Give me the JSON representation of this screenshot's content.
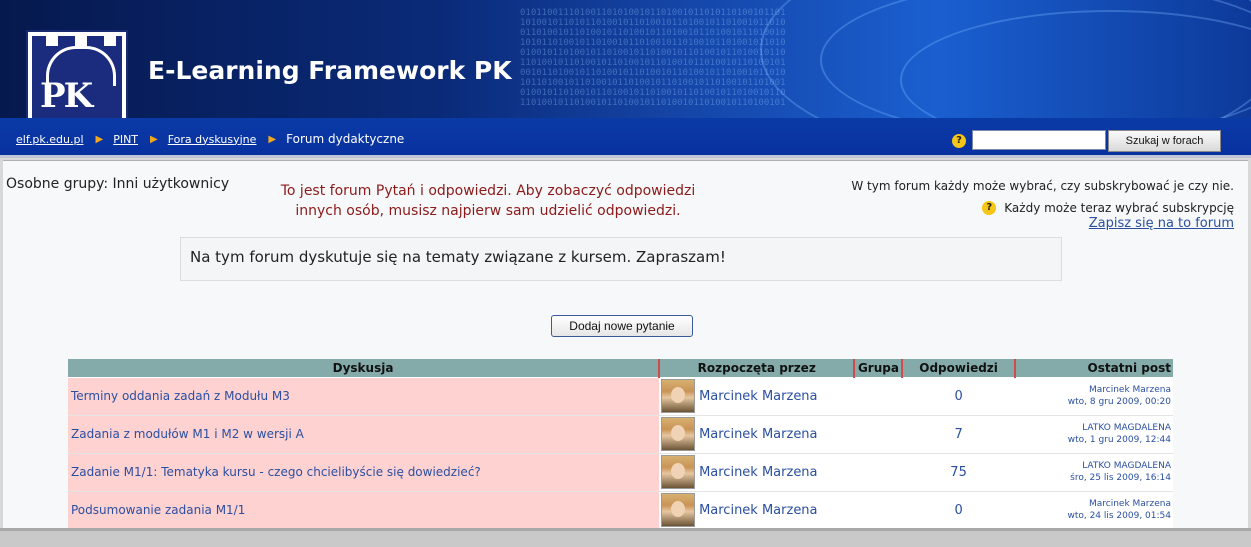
{
  "header": {
    "site_title": "E-Learning Framework PK",
    "logo_text": "PK"
  },
  "breadcrumb": {
    "items": [
      "elf.pk.edu.pl",
      "PINT",
      "Fora dyskusyjne"
    ],
    "current": "Forum dydaktyczne"
  },
  "search": {
    "value": "",
    "button_label": "Szukaj w forach",
    "help_icon": "?"
  },
  "forum": {
    "groups_label": "Osobne grupy: Inni użytkownicy",
    "qa_notice_line1": "To jest forum Pytań i odpowiedzi. Aby zobaczyć odpowiedzi",
    "qa_notice_line2": "innych osób, musisz najpierw sam udzielić odpowiedzi.",
    "subscribe_info_line1": "W tym forum każdy może wybrać, czy subskrybować je czy nie.",
    "subscribe_info_line2": "Każdy może teraz wybrać subskrypcję",
    "subscribe_help_icon": "?",
    "subscribe_link": "Zapisz się na to forum",
    "intro": "Na tym forum dyskutuje się na tematy związane z kursem. Zapraszam!",
    "add_question_label": "Dodaj nowe pytanie"
  },
  "table": {
    "headers": [
      "Dyskusja",
      "Rozpoczęta przez",
      "Grupa",
      "Odpowiedzi",
      "Ostatni post"
    ],
    "rows": [
      {
        "topic": "Terminy oddania zadań z Modułu M3",
        "author": "Marcinek Marzena",
        "group": "",
        "replies": "0",
        "last_author": "Marcinek Marzena",
        "last_date": "wto, 8 gru 2009, 00:20"
      },
      {
        "topic": "Zadania z modułów M1 i M2 w wersji A",
        "author": "Marcinek Marzena",
        "group": "",
        "replies": "7",
        "last_author": "LATKO MAGDALENA",
        "last_date": "wto, 1 gru 2009, 12:44"
      },
      {
        "topic": "Zadanie M1/1: Tematyka kursu - czego chcielibyście się dowiedzieć?",
        "author": "Marcinek Marzena",
        "group": "",
        "replies": "75",
        "last_author": "LATKO MAGDALENA",
        "last_date": "śro, 25 lis 2009, 16:14"
      },
      {
        "topic": "Podsumowanie zadania M1/1",
        "author": "Marcinek Marzena",
        "group": "",
        "replies": "0",
        "last_author": "Marcinek Marzena",
        "last_date": "wto, 24 lis 2009, 01:54"
      }
    ]
  },
  "colors": {
    "nav_bg": "#0a3aa6",
    "table_header_bg": "#84aaaa",
    "topic_cell_bg": "#ffd2d2",
    "link": "#2a4fa0",
    "notice": "#8b1a1a"
  }
}
